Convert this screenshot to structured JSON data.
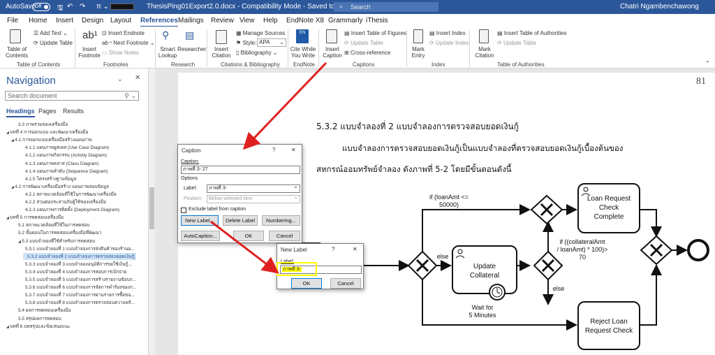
{
  "titlebar": {
    "autosave": "AutoSave",
    "autosave_state": "Off",
    "doc_title": "ThesisPing01Export2.0.docx  -  Compatibility Mode  -  Saved to this PC",
    "search": "Search",
    "user": "Chatri Ngambenchawong"
  },
  "tabs": [
    "File",
    "Home",
    "Insert",
    "Design",
    "Layout",
    "References",
    "Mailings",
    "Review",
    "View",
    "Help",
    "EndNote X8",
    "Grammarly",
    "iThesis"
  ],
  "ribbon": {
    "toc": {
      "btn": "Table of Contents",
      "add_text": "Add Text",
      "update_table": "Update Table",
      "group": "Table of Contents"
    },
    "footnotes": {
      "insert_footnote": "Insert Footnote",
      "insert_endnote": "Insert Endnote",
      "next_footnote": "Next Footnote",
      "show_notes": "Show Notes",
      "group": "Footnotes"
    },
    "research": {
      "smart_lookup": "Smart Lookup",
      "researcher": "Researcher",
      "group": "Research"
    },
    "citations": {
      "insert_citation": "Insert Citation",
      "manage_sources": "Manage Sources",
      "style_label": "Style:",
      "style_value": "APA",
      "bibliography": "Bibliography",
      "group": "Citations & Bibliography"
    },
    "endnote": {
      "cite_while": "Cite While You Write",
      "group": "EndNote"
    },
    "captions": {
      "insert_caption": "Insert Caption",
      "insert_tof": "Insert Table of Figures",
      "update_table": "Update Table",
      "cross_ref": "Cross-reference",
      "group": "Captions"
    },
    "index": {
      "mark_entry": "Mark Entry",
      "insert_index": "Insert Index",
      "update_index": "Update Index",
      "group": "Index"
    },
    "toa": {
      "mark_citation": "Mark Citation",
      "insert_toa": "Insert Table of Authorities",
      "update_table": "Update Table",
      "group": "Table of Authorities"
    }
  },
  "nav": {
    "title": "Navigation",
    "search_placeholder": "Search document",
    "tabs": [
      "Headings",
      "Pages",
      "Results"
    ],
    "items": [
      "3.3 ภาพรวมของเครื่องมือ",
      "บทที่ 4 การออกแบบ และพัฒนาเครื่องมือ",
      "4.1 การออกแบบเครื่องมือสร้างแผนภาพ",
      "4.1.1 แผนภาพยูสเคส (Use Case Diagram)",
      "4.1.2 แผนภาพกิจกรรม (Activity Diagram)",
      "4.1.3 แผนภาพคลาส (Class Diagram)",
      "4.1.4 แผนภาพลำดับ (Sequence Diagram)",
      "4.1.5 โครงสร้างฐานข้อมูล",
      "4.2 การพัฒนาเครื่องมือสร้าง แผนภาพสอบข้อมูล",
      "4.2.1 สภาพแวดล้อมที่ใช้ในการพัฒนาเครื่องมือ",
      "4.2.2 ส่วนต่อประสานกับผู้ใช้ของเครื่องมือ",
      "4.2.3 แผนภาพการติดตั้ง (Deployment Diagram)",
      "บทที่ 5 การทดสอบเครื่องมือ",
      "5.1 สภาพแวดล้อมที่ใช้ในการทดสอบ",
      "5.2 ขั้นตอนในการทดสอบเครื่องมือที่พัฒนา",
      "5.3 แบบจำลองที่ใช้สำหรับการทดสอบ",
      "5.3.1 แบบจำลองที่ 1 แบบจำลองการส่งสินค้าของร้านอ...",
      "5.3.2 แบบจำลองที่ 2 แบบจำลองการตรวจสอบยอดเงินกู้",
      "5.3.3 แบบจำลองที่ 3 แบบจำลองอนุมัติการขอใช้เงินกู้...",
      "5.3.4 แบบจำลองที่ 4 แบบจำลองการสอบการเบิกจ่าย",
      "5.3.5 แบบจำลองที่ 5 แบบจำลองการสร้างรายงานข้อบก...",
      "5.3.6 แบบจำลองที่ 6 แบบจำลองการจัดการคำร้องของก...",
      "5.3.7 แบบจำลองที่ 7 แบบจำลองการผ่านรายการซื้อขอ...",
      "5.3.8 แบบจำลองที่ 8 แบบจำลองการตรวจสอบความพร้...",
      "5.4 ผลการทดสอบเครื่องมือ",
      "5.5 สรุปผลการทดสอบ",
      "บทที่ 6 บทสรุปและข้อเสนอแนะ"
    ]
  },
  "doc": {
    "page_number": "81",
    "heading": "5.3.2 แบบจำลองที่ 2 แบบจำลองการตรวจสอบยอดเงินกู้",
    "para1": "แบบจำลองการตรวจสอบยอดเงินกู้เป็นแบบจำลองที่ตรวจสอบยอดเงินกู้เบื้องต้นของ",
    "para2": "สหกรณ์ออมทรัพย์จำลอง ดังภาพที่ 5-2 โดยมีขั้นตอนดังนี้"
  },
  "diagram": {
    "task_approve": [
      "Loan Request",
      "Check",
      "Complete"
    ],
    "task_reject": [
      "Reject Loan",
      "Request Check"
    ],
    "task_update": [
      "Update",
      "Collateral"
    ],
    "task_left": [
      "oan",
      "nt"
    ],
    "cond_top": [
      "if (loanAmt <=",
      "50000)"
    ],
    "cond_mid": [
      "if ((collateralAmt",
      "/ loanAmt) * 100)>",
      "70"
    ],
    "else1": "else",
    "else2": "else",
    "timer": [
      "Wait for",
      "5 Minutes"
    ]
  },
  "caption_dialog": {
    "title": "Caption",
    "help": "?",
    "close": "✕",
    "caption_label": "Caption:",
    "caption_value": "ภาพที่ 3- 27",
    "options": "Options",
    "label_label": "Label:",
    "label_value": "ภาพที่ 3-",
    "position_label": "Position:",
    "position_value": "Below selected item",
    "exclude": "Exclude label from caption",
    "new_label": "New Label...",
    "delete_label": "Delete Label",
    "numbering": "Numbering...",
    "autocaption": "AutoCaption...",
    "ok": "OK",
    "cancel": "Cancel"
  },
  "newlabel_dialog": {
    "title": "New Label",
    "help": "?",
    "close": "✕",
    "label": "Label:",
    "value": "ภาพที่ 3-",
    "ok": "OK",
    "cancel": "Cancel"
  },
  "colors": {
    "brand": "#2b579a",
    "arrow": "#e02020",
    "highlight": "#ffff00"
  }
}
